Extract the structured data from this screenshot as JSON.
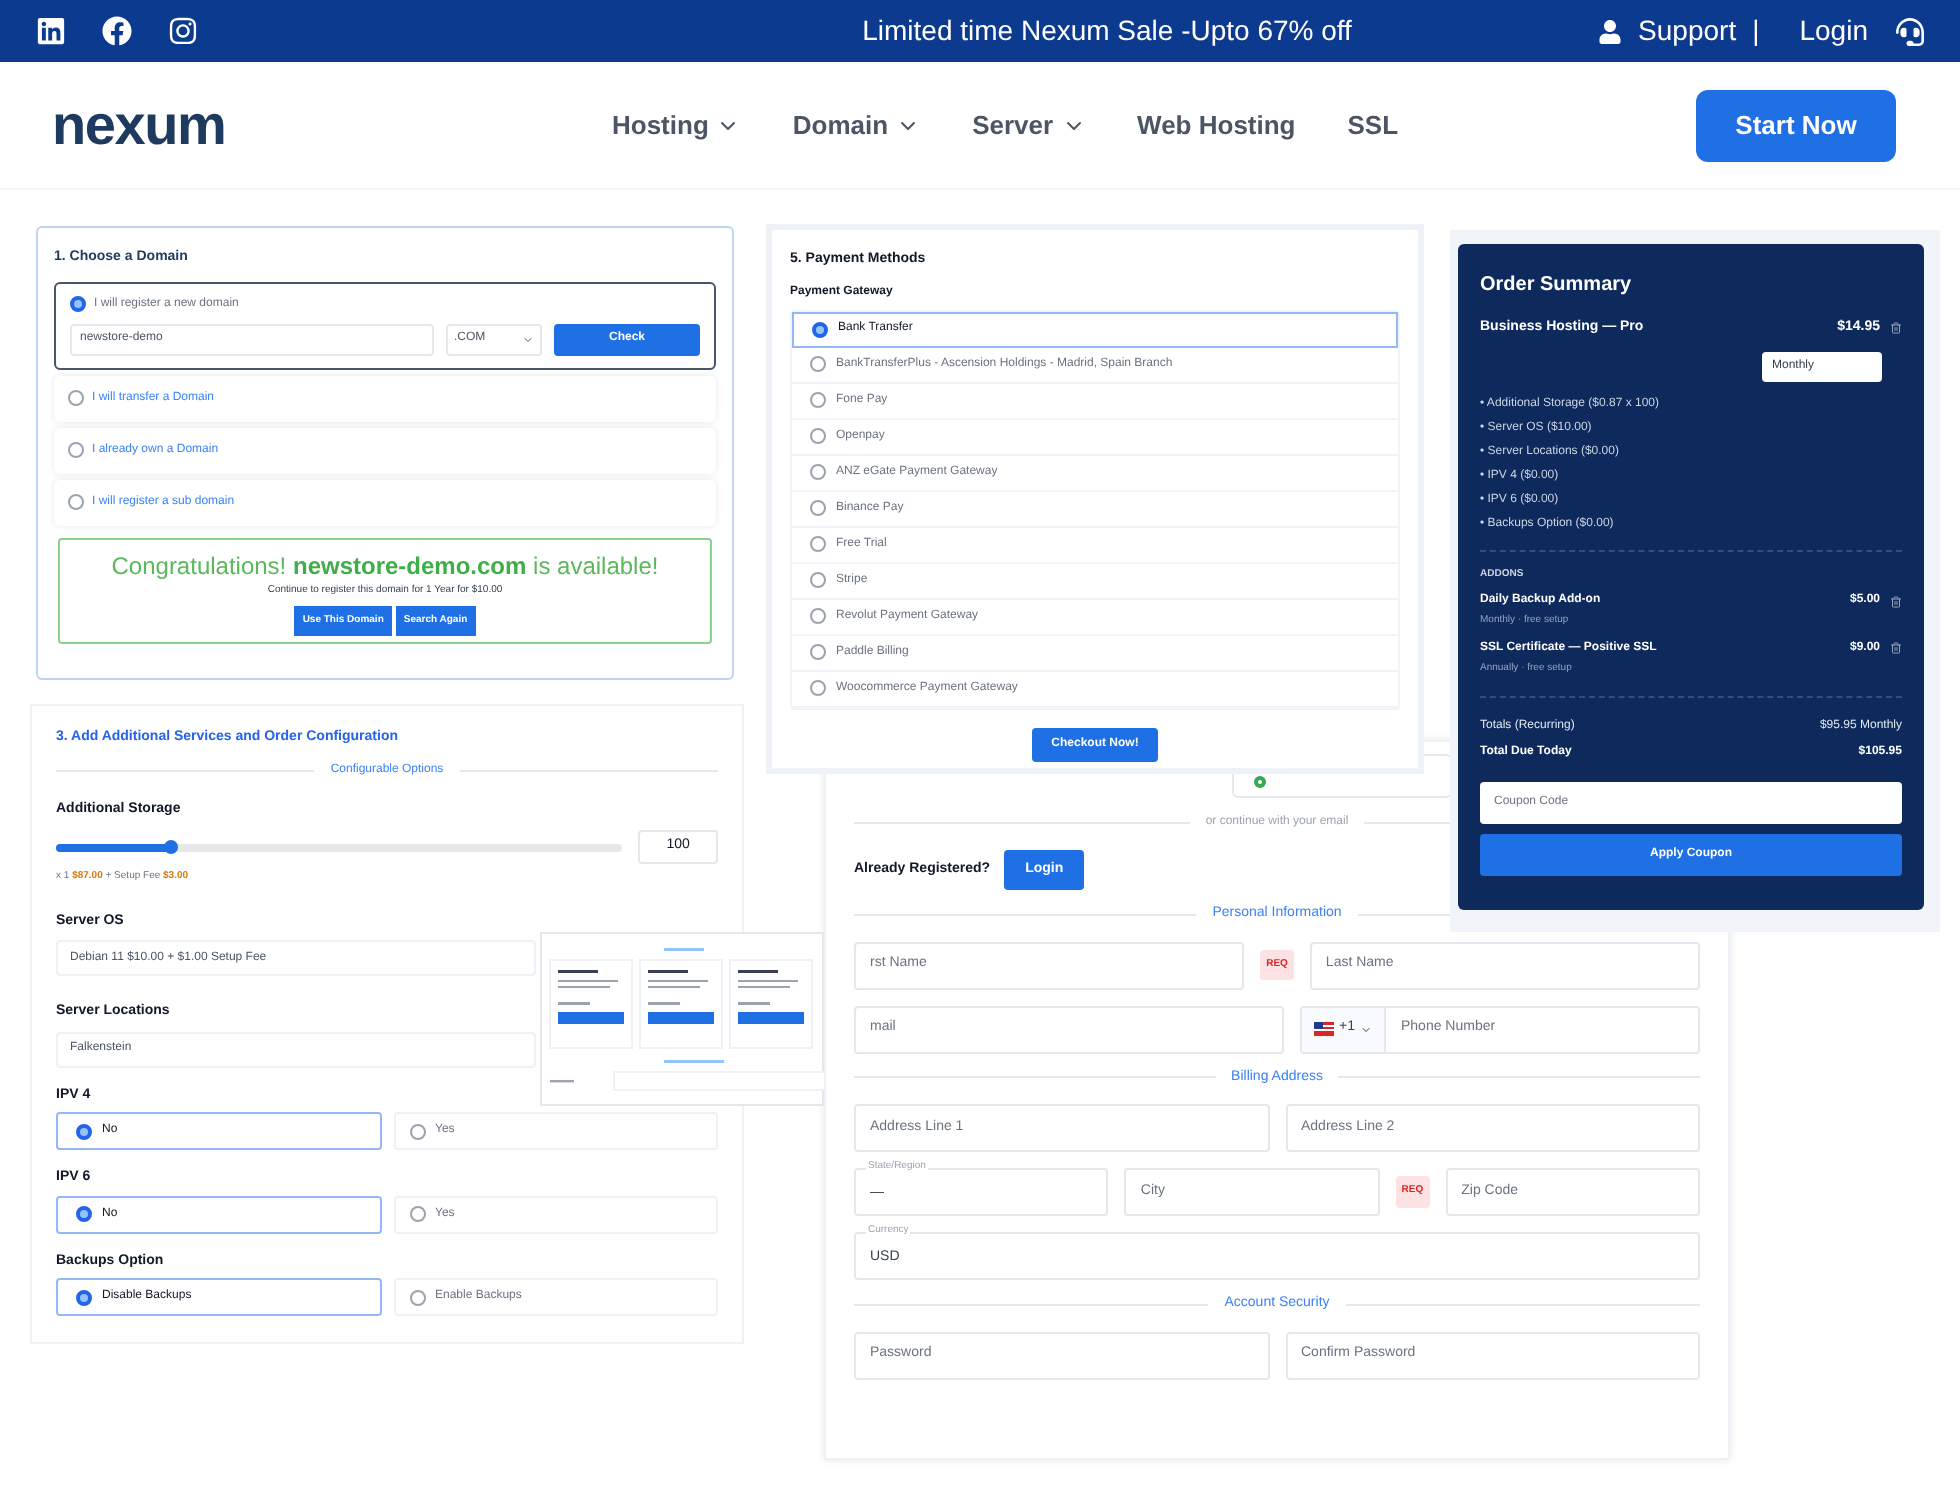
{
  "topbar": {
    "promo": "Limited time Nexum Sale -Upto 67% off",
    "support": "Support",
    "separator": "|",
    "login": "Login"
  },
  "nav": {
    "logo": "nexum",
    "items": [
      {
        "label": "Hosting",
        "dropdown": true
      },
      {
        "label": "Domain",
        "dropdown": true
      },
      {
        "label": "Server",
        "dropdown": true
      },
      {
        "label": "Web Hosting",
        "dropdown": false
      },
      {
        "label": "SSL",
        "dropdown": false
      }
    ],
    "cta": "Start Now"
  },
  "domain": {
    "title": "1. Choose a Domain",
    "options": [
      {
        "label": "I will register a new domain",
        "selected": true
      },
      {
        "label": "I will transfer a Domain",
        "selected": false
      },
      {
        "label": "I already own a Domain",
        "selected": false
      },
      {
        "label": "I will register a sub domain",
        "selected": false
      }
    ],
    "input_value": "newstore-demo",
    "tld": ".COM",
    "check": "Check",
    "result": {
      "message": "Congratulations! **newstore-demo.com** is available!",
      "note": "Continue to register this domain for 1 Year for $10.00",
      "buttons": [
        "Use This Domain",
        "Search Again"
      ]
    }
  },
  "config": {
    "title": "3. Add Additional Services and Order Configuration",
    "divider": "Configurable Options",
    "storage": {
      "label": "Additional Storage",
      "level": 0.2,
      "value": "100",
      "price": "x 1 **$87.00** + Setup Fee **$3.00**"
    },
    "selects": [
      {
        "label": "Server OS",
        "value": "Debian 11 $10.00 + $1.00 Setup Fee"
      },
      {
        "label": "Server Locations",
        "value": "Falkenstein"
      }
    ],
    "radio_groups": [
      {
        "label": "IPV 4",
        "options": [
          {
            "label": "No",
            "selected": true
          },
          {
            "label": "Yes",
            "selected": false
          }
        ]
      },
      {
        "label": "IPV 6",
        "options": [
          {
            "label": "No",
            "selected": true
          },
          {
            "label": "Yes",
            "selected": false
          }
        ]
      },
      {
        "label": "Backups Option",
        "options": [
          {
            "label": "Disable Backups",
            "selected": true
          },
          {
            "label": "Enable Backups",
            "selected": false
          }
        ]
      }
    ]
  },
  "payment": {
    "title": "5. Payment Methods",
    "subtitle": "Payment Gateway",
    "methods": [
      {
        "label": "Bank Transfer",
        "selected": true
      },
      {
        "label": "BankTransferPlus - Ascension Holdings - Madrid, Spain Branch",
        "selected": false
      },
      {
        "label": "Fone Pay",
        "selected": false
      },
      {
        "label": "Openpay",
        "selected": false
      },
      {
        "label": "ANZ eGate Payment Gateway",
        "selected": false
      },
      {
        "label": "Binance Pay",
        "selected": false
      },
      {
        "label": "Free Trial",
        "selected": false
      },
      {
        "label": "Stripe",
        "selected": false
      },
      {
        "label": "Revolut Payment Gateway",
        "selected": false
      },
      {
        "label": "Paddle Billing",
        "selected": false
      },
      {
        "label": "Woocommerce Payment Gateway",
        "selected": false
      }
    ],
    "button": "Checkout Now!"
  },
  "summary": {
    "title": "Order Summary",
    "product": {
      "name": "Business Hosting — Pro",
      "price": "$14.95",
      "cycle": "Monthly"
    },
    "items": [
      "• Additional Storage ($0.87 x 100)",
      "• Server OS ($10.00)",
      "• Server Locations ($0.00)",
      "• IPV 4 ($0.00)",
      "• IPV 6 ($0.00)",
      "• Backups Option ($0.00)"
    ],
    "addons_label": "ADDONS",
    "addons": [
      {
        "name": "Daily Backup Add-on",
        "price": "$5.00",
        "note": "Monthly · free setup"
      },
      {
        "name": "SSL Certificate — Positive SSL",
        "price": "$9.00",
        "note": "Annually · free setup"
      }
    ],
    "totals": [
      {
        "kind": "recurring",
        "label": "Totals (Recurring)",
        "value": "$95.95 Monthly"
      },
      {
        "kind": "due",
        "label": "Total Due Today",
        "value": "$105.95"
      }
    ],
    "coupon_placeholder": "Coupon Code",
    "apply": "Apply Coupon"
  },
  "account": {
    "or_divider": "or continue with your email",
    "registered": "Already Registered?",
    "login": "Login",
    "sections": [
      {
        "title": "Personal Information",
        "lines": [
          {
            "fields": [
              {
                "kind": "input",
                "placeholder": "rst Name"
              },
              {
                "kind": "req",
                "label": "REQ"
              },
              {
                "kind": "input",
                "placeholder": "Last Name"
              }
            ]
          },
          {
            "fields": [
              {
                "kind": "input",
                "placeholder": "mail"
              },
              {
                "kind": "phone",
                "code": "+1",
                "placeholder": "Phone Number"
              }
            ]
          }
        ]
      },
      {
        "title": "Billing Address",
        "lines": [
          {
            "fields": [
              {
                "kind": "input",
                "placeholder": "Address Line 1"
              },
              {
                "kind": "input",
                "placeholder": "Address Line 2"
              }
            ]
          },
          {
            "fields": [
              {
                "kind": "floating",
                "label": "State/Region",
                "value": "—"
              },
              {
                "kind": "input",
                "placeholder": "City"
              },
              {
                "kind": "req",
                "label": "REQ"
              },
              {
                "kind": "input",
                "placeholder": "Zip Code"
              }
            ]
          },
          {
            "fields": [
              {
                "kind": "floating",
                "label": "Currency",
                "value": "USD"
              }
            ]
          }
        ]
      },
      {
        "title": "Account Security",
        "lines": [
          {
            "fields": [
              {
                "kind": "input",
                "placeholder": "Password"
              },
              {
                "kind": "input",
                "placeholder": "Confirm Password"
              }
            ]
          }
        ]
      }
    ]
  }
}
